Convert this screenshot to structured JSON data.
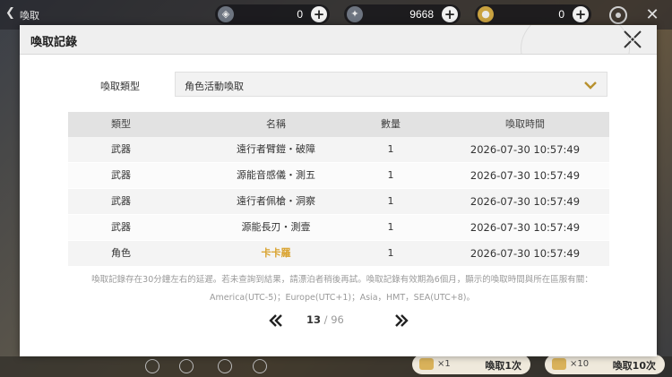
{
  "topbar": {
    "page_name": "喚取",
    "currencies": [
      {
        "icon": "gem-icon",
        "value": "0"
      },
      {
        "icon": "star-icon",
        "value": "9668"
      },
      {
        "icon": "coin-icon",
        "value": "0"
      }
    ]
  },
  "modal": {
    "title": "喚取記錄",
    "type_label": "喚取類型",
    "type_value": "角色活動喚取",
    "columns": [
      "類型",
      "名稱",
      "數量",
      "喚取時間"
    ],
    "rows": [
      {
        "type": "武器",
        "name": "遠行者臂鎧・破障",
        "qty": "1",
        "time": "2026-07-30 10:57:49"
      },
      {
        "type": "武器",
        "name": "源能音感儀・測五",
        "qty": "1",
        "time": "2026-07-30 10:57:49"
      },
      {
        "type": "武器",
        "name": "遠行者佩槍・洞察",
        "qty": "1",
        "time": "2026-07-30 10:57:49"
      },
      {
        "type": "武器",
        "name": "源能長刃・測壹",
        "qty": "1",
        "time": "2026-07-30 10:57:49"
      },
      {
        "type": "角色",
        "name": "卡卡羅",
        "qty": "1",
        "time": "2026-07-30 10:57:49"
      }
    ],
    "note_line1": "喚取記錄存在30分鐘左右的延遲。若未查詢到結果，請漂泊者稍後再試。喚取記錄有效期為6個月，顯示的喚取時間與所在區服有關：",
    "note_line2": "America(UTC-5)；Europe(UTC+1)；Asia，HMT，SEA(UTC+8)。",
    "pager": {
      "current": "13",
      "total": "/ 96"
    }
  },
  "bottom": {
    "pull_once": {
      "count": "×1",
      "label": "喚取1次"
    },
    "pull_ten": {
      "count": "×10",
      "label": "喚取10次"
    }
  },
  "colors": {
    "highlight_name": "#d9a22d"
  }
}
